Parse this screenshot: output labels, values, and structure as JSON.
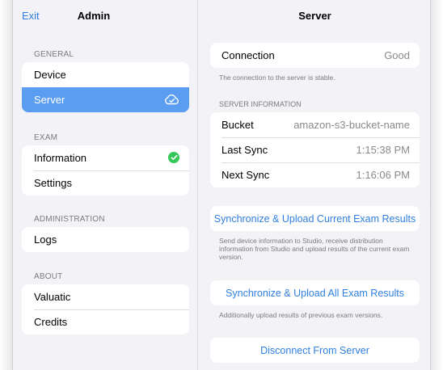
{
  "sidebar": {
    "exit_label": "Exit",
    "title": "Admin",
    "sections": [
      {
        "header": "GENERAL",
        "items": [
          {
            "label": "Device"
          },
          {
            "label": "Server",
            "selected": true,
            "icon": "cloud-check-icon"
          }
        ]
      },
      {
        "header": "EXAM",
        "items": [
          {
            "label": "Information",
            "icon": "green-check-icon"
          },
          {
            "label": "Settings"
          }
        ]
      },
      {
        "header": "ADMINISTRATION",
        "items": [
          {
            "label": "Logs"
          }
        ]
      },
      {
        "header": "ABOUT",
        "items": [
          {
            "label": "Valuatic"
          },
          {
            "label": "Credits"
          }
        ]
      }
    ]
  },
  "detail": {
    "title": "Server",
    "connection": {
      "label": "Connection",
      "value": "Good",
      "footnote": "The connection to the server is stable."
    },
    "server_info": {
      "header": "SERVER INFORMATION",
      "rows": [
        {
          "label": "Bucket",
          "value": "amazon-s3-bucket-name"
        },
        {
          "label": "Last Sync",
          "value": "1:15:38 PM"
        },
        {
          "label": "Next Sync",
          "value": "1:16:06 PM"
        }
      ]
    },
    "sync_current": {
      "label": "Synchronize & Upload Current Exam Results",
      "footnote": "Send device information to Studio, receive distribution information from Studio and upload results of the current exam version."
    },
    "sync_all": {
      "label": "Synchronize & Upload All Exam Results",
      "footnote": "Additionally upload results of previous exam versions."
    },
    "disconnect": {
      "label": "Disconnect From Server"
    }
  },
  "colors": {
    "accent": "#2f7fe0",
    "selected": "#5b9df0",
    "success": "#34c759"
  }
}
